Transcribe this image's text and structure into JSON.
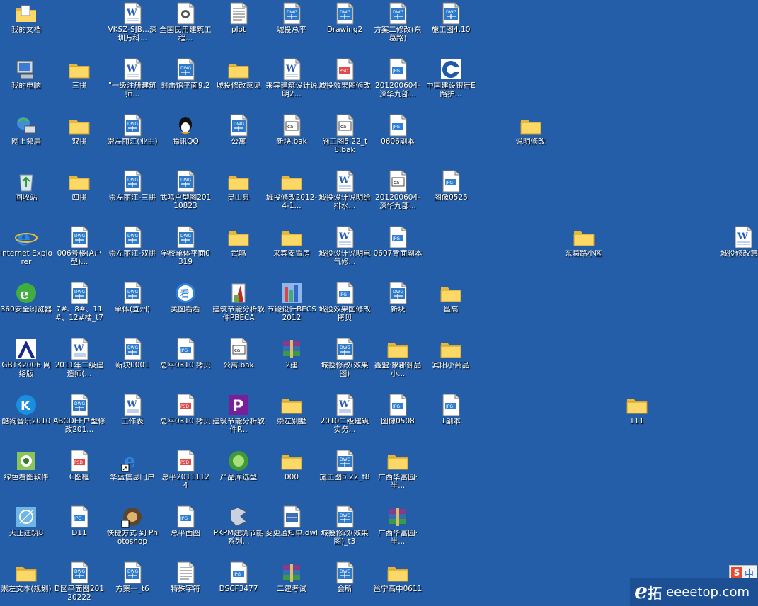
{
  "desktop": {
    "background": "#245ea8",
    "icons": [
      {
        "label": "我的文档",
        "type": "mydocs",
        "col": 0,
        "row": 0
      },
      {
        "label": "我的电脑",
        "type": "mycomputer",
        "col": 0,
        "row": 1
      },
      {
        "label": "网上邻居",
        "type": "network",
        "col": 0,
        "row": 2
      },
      {
        "label": "回收站",
        "type": "recycle",
        "col": 0,
        "row": 3
      },
      {
        "label": "Internet Explorer",
        "type": "ie",
        "col": 0,
        "row": 4
      },
      {
        "label": "360安全浏览器",
        "type": "browser360",
        "col": 0,
        "row": 5
      },
      {
        "label": "GBTK2006 网络版",
        "type": "gbtk",
        "col": 0,
        "row": 6
      },
      {
        "label": "酷狗音乐2010",
        "type": "kugou",
        "col": 0,
        "row": 7
      },
      {
        "label": "绿色看图软件",
        "type": "viewer",
        "col": 0,
        "row": 8
      },
      {
        "label": "天正建筑8",
        "type": "tangent",
        "col": 0,
        "row": 9
      },
      {
        "label": "崇左文本(规划)",
        "type": "folder",
        "col": 0,
        "row": 10
      },
      {
        "label": "三拼",
        "type": "folder",
        "col": 1,
        "row": 1
      },
      {
        "label": "双拼",
        "type": "folder",
        "col": 1,
        "row": 2
      },
      {
        "label": "四拼",
        "type": "folder",
        "col": 1,
        "row": 3
      },
      {
        "label": "006号楼(A户型)...",
        "type": "dwg",
        "col": 1,
        "row": 4
      },
      {
        "label": "7#、8#、11#、12#楼_t7",
        "type": "dwg",
        "col": 1,
        "row": 5
      },
      {
        "label": "2011年二级建造师(...",
        "type": "word",
        "col": 1,
        "row": 6
      },
      {
        "label": "ABCDEF户型修改201...",
        "type": "dwg",
        "col": 1,
        "row": 7
      },
      {
        "label": "C图框",
        "type": "psd",
        "col": 1,
        "row": 8
      },
      {
        "label": "D11",
        "type": "jpg",
        "col": 1,
        "row": 9
      },
      {
        "label": "D区平面图20120222",
        "type": "dwg",
        "col": 1,
        "row": 10
      },
      {
        "label": "VKSZ-SJB...深圳万科...",
        "type": "word",
        "col": 2,
        "row": 0
      },
      {
        "label": "\"一级注册建筑师...",
        "type": "word",
        "col": 2,
        "row": 1
      },
      {
        "label": "崇左丽江(业主)",
        "type": "dwg",
        "col": 2,
        "row": 2
      },
      {
        "label": "崇左丽江-三拼",
        "type": "dwg",
        "col": 2,
        "row": 3
      },
      {
        "label": "崇左丽江-双拼",
        "type": "dwg",
        "col": 2,
        "row": 4
      },
      {
        "label": "单体(宜州)",
        "type": "dwg",
        "col": 2,
        "row": 5
      },
      {
        "label": "新块0001",
        "type": "dwg",
        "col": 2,
        "row": 6
      },
      {
        "label": "工作表",
        "type": "word",
        "col": 2,
        "row": 7
      },
      {
        "label": "华蓝信息门户",
        "type": "ieshortcut",
        "col": 2,
        "row": 8
      },
      {
        "label": "快捷方式 到 Photoshop",
        "type": "photoshop",
        "col": 2,
        "row": 9
      },
      {
        "label": "方案一_t6",
        "type": "dwg",
        "col": 2,
        "row": 10
      },
      {
        "label": "全国民用建筑工程...",
        "type": "ppt",
        "col": 3,
        "row": 0
      },
      {
        "label": "射击馆平面9.2",
        "type": "dwg",
        "col": 3,
        "row": 1
      },
      {
        "label": "腾讯QQ",
        "type": "qq",
        "col": 3,
        "row": 2
      },
      {
        "label": "武鸣户型图20110823",
        "type": "dwg",
        "col": 3,
        "row": 3
      },
      {
        "label": "学校单体平面0319",
        "type": "dwg",
        "col": 3,
        "row": 4
      },
      {
        "label": "美图看看",
        "type": "meitu",
        "col": 3,
        "row": 5
      },
      {
        "label": "总平0310 拷贝",
        "type": "jpg",
        "col": 3,
        "row": 6
      },
      {
        "label": "总平0310 拷贝",
        "type": "psd",
        "col": 3,
        "row": 7
      },
      {
        "label": "总平20111124",
        "type": "psd",
        "col": 3,
        "row": 8
      },
      {
        "label": "总平面图",
        "type": "jpg",
        "col": 3,
        "row": 9
      },
      {
        "label": "特殊字符",
        "type": "txt",
        "col": 3,
        "row": 10
      },
      {
        "label": "plot",
        "type": "txt",
        "col": 4,
        "row": 0
      },
      {
        "label": "城投修改意见",
        "type": "folder",
        "col": 4,
        "row": 1
      },
      {
        "label": "公寓",
        "type": "dwg",
        "col": 4,
        "row": 2
      },
      {
        "label": "灵山县",
        "type": "folder",
        "col": 4,
        "row": 3
      },
      {
        "label": "武鸣",
        "type": "folder",
        "col": 4,
        "row": 4
      },
      {
        "label": "建筑节能分析软件PBECA",
        "type": "pbeca",
        "col": 4,
        "row": 5
      },
      {
        "label": "公寓.bak",
        "type": "bak",
        "col": 4,
        "row": 6
      },
      {
        "label": "建筑节能分析软件P...",
        "type": "pkpm_p",
        "col": 4,
        "row": 7
      },
      {
        "label": "产品库选型",
        "type": "product",
        "col": 4,
        "row": 8
      },
      {
        "label": "PKPM建筑节能系列...",
        "type": "pkpm",
        "col": 4,
        "row": 9
      },
      {
        "label": "DSCF3477",
        "type": "jpg",
        "col": 4,
        "row": 10
      },
      {
        "label": "城投总平",
        "type": "dwg",
        "col": 5,
        "row": 0
      },
      {
        "label": "来宾建筑设计说明2...",
        "type": "word",
        "col": 5,
        "row": 1
      },
      {
        "label": "新块.bak",
        "type": "bak",
        "col": 5,
        "row": 2
      },
      {
        "label": "城投修改2012-4-1...",
        "type": "folder",
        "col": 5,
        "row": 3
      },
      {
        "label": "来宾安置房",
        "type": "folder",
        "col": 5,
        "row": 4
      },
      {
        "label": "节能设计BECS2012",
        "type": "becs",
        "col": 5,
        "row": 5
      },
      {
        "label": "2建",
        "type": "rar",
        "col": 5,
        "row": 6
      },
      {
        "label": "崇左别墅",
        "type": "folder",
        "col": 5,
        "row": 7
      },
      {
        "label": "000",
        "type": "folder",
        "col": 5,
        "row": 8
      },
      {
        "label": "变更通知单.dwl",
        "type": "dwl",
        "col": 5,
        "row": 9
      },
      {
        "label": "二建考试",
        "type": "rar",
        "col": 5,
        "row": 10
      },
      {
        "label": "Drawing2",
        "type": "dwg",
        "col": 6,
        "row": 0
      },
      {
        "label": "城投效果图修改",
        "type": "psd",
        "col": 6,
        "row": 1
      },
      {
        "label": "施工图5.22_t8.bak",
        "type": "bak",
        "col": 6,
        "row": 2
      },
      {
        "label": "城投设计说明给排水...",
        "type": "word",
        "col": 6,
        "row": 3
      },
      {
        "label": "城投设计说明电气修...",
        "type": "word",
        "col": 6,
        "row": 4
      },
      {
        "label": "城投效果图修改 拷贝",
        "type": "jpg",
        "col": 6,
        "row": 5
      },
      {
        "label": "城投修改(效果图)",
        "type": "dwg",
        "col": 6,
        "row": 6
      },
      {
        "label": "2010二级建筑实务...",
        "type": "word",
        "col": 6,
        "row": 7
      },
      {
        "label": "施工图5.22_t8",
        "type": "dwg",
        "col": 6,
        "row": 8
      },
      {
        "label": "城投修改(效果图)_t3",
        "type": "dwg",
        "col": 6,
        "row": 9
      },
      {
        "label": "会所",
        "type": "dwg",
        "col": 6,
        "row": 10
      },
      {
        "label": "方案二修改(东葛路)",
        "type": "dwg",
        "col": 7,
        "row": 0
      },
      {
        "label": "201200604-深华九部...",
        "type": "jpg",
        "col": 7,
        "row": 1
      },
      {
        "label": "0606副本",
        "type": "jpg",
        "col": 7,
        "row": 2
      },
      {
        "label": "201200604-深华九部...",
        "type": "bak",
        "col": 7,
        "row": 3
      },
      {
        "label": "0607背面副本",
        "type": "jpg",
        "col": 7,
        "row": 4
      },
      {
        "label": "新块",
        "type": "dwg",
        "col": 7,
        "row": 5
      },
      {
        "label": "鑫盟·象郡御品小...",
        "type": "folder",
        "col": 7,
        "row": 6
      },
      {
        "label": "图像0508",
        "type": "jpg",
        "col": 7,
        "row": 7
      },
      {
        "label": "广西华富园·半...",
        "type": "folder",
        "col": 7,
        "row": 8
      },
      {
        "label": "广西华富园·半...",
        "type": "rar",
        "col": 7,
        "row": 9
      },
      {
        "label": "邕宁高中0611",
        "type": "folder",
        "col": 7,
        "row": 10
      },
      {
        "label": "施工图4.10",
        "type": "dwg",
        "col": 8,
        "row": 0
      },
      {
        "label": "中国建设银行E路护...",
        "type": "ccb",
        "col": 8,
        "row": 1
      },
      {
        "label": "图像0525",
        "type": "jpg",
        "col": 8,
        "row": 3
      },
      {
        "label": "邕高",
        "type": "folder",
        "col": 8,
        "row": 5
      },
      {
        "label": "宾阳小商品",
        "type": "folder",
        "col": 8,
        "row": 6
      },
      {
        "label": "1副本",
        "type": "jpg",
        "col": 8,
        "row": 7
      },
      {
        "label": "说明修改",
        "type": "folder",
        "col": 9.5,
        "row": 2
      },
      {
        "label": "东葛路小区",
        "type": "folder",
        "col": 10.5,
        "row": 4
      },
      {
        "label": "城投修改意见",
        "type": "word",
        "col": 13.5,
        "row": 4
      },
      {
        "label": "111",
        "type": "folder",
        "col": 11.5,
        "row": 7
      }
    ]
  },
  "ime": {
    "s": "S",
    "zh": "中"
  },
  "watermark": {
    "e": "e",
    "tuo": "拓",
    "domain": "eeeetop.com"
  }
}
